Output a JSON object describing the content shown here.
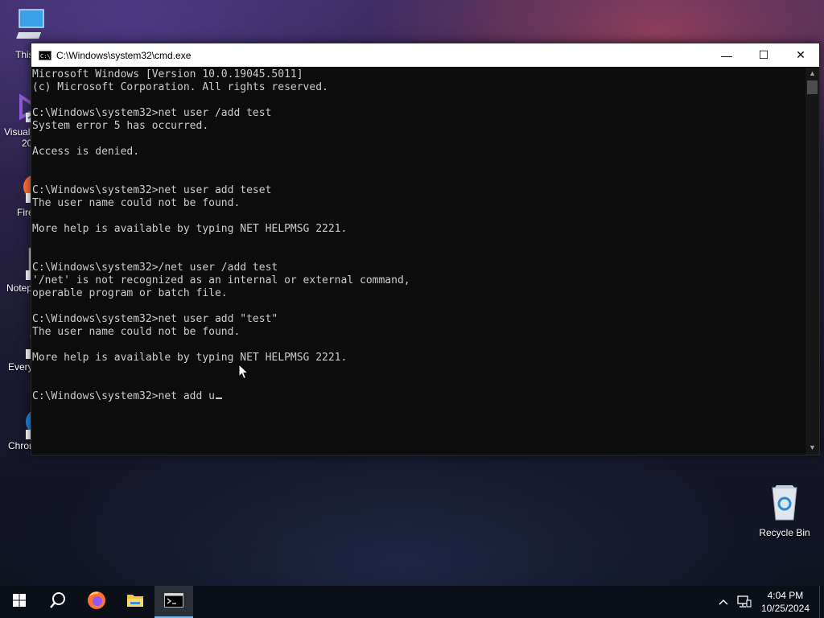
{
  "desktop": {
    "icons": [
      {
        "label": "This"
      },
      {
        "label": "Visual"
      },
      {
        "label": "20"
      },
      {
        "label": "Fire"
      },
      {
        "label": "Notep"
      },
      {
        "label": "Every"
      },
      {
        "label": "Chrom..."
      }
    ],
    "recycle_bin_label": "Recycle Bin"
  },
  "window": {
    "title": "C:\\Windows\\system32\\cmd.exe",
    "minimize_glyph": "—",
    "maximize_glyph": "☐",
    "close_glyph": "✕"
  },
  "console": {
    "lines": [
      "Microsoft Windows [Version 10.0.19045.5011]",
      "(c) Microsoft Corporation. All rights reserved.",
      "",
      "C:\\Windows\\system32>net user /add test",
      "System error 5 has occurred.",
      "",
      "Access is denied.",
      "",
      "",
      "C:\\Windows\\system32>net user add teset",
      "The user name could not be found.",
      "",
      "More help is available by typing NET HELPMSG 2221.",
      "",
      "",
      "C:\\Windows\\system32>/net user /add test",
      "'/net' is not recognized as an internal or external command,",
      "operable program or batch file.",
      "",
      "C:\\Windows\\system32>net user add \"test\"",
      "The user name could not be found.",
      "",
      "More help is available by typing NET HELPMSG 2221.",
      "",
      ""
    ],
    "prompt": "C:\\Windows\\system32>",
    "current_input": "net add u"
  },
  "taskbar": {
    "start_icon": "windows-logo-icon",
    "search_icon": "search-icon",
    "apps": [
      "firefox-icon",
      "file-explorer-icon",
      "command-prompt-icon"
    ],
    "tray": {
      "time": "4:04 PM",
      "date": "10/25/2024"
    }
  }
}
